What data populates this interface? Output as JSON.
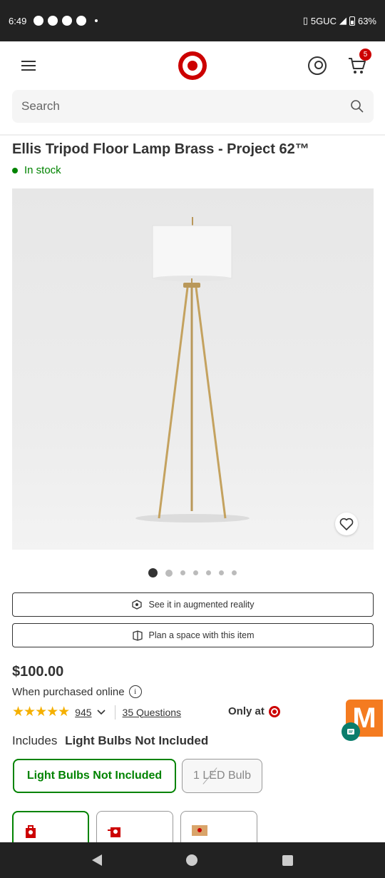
{
  "status_bar": {
    "time": "6:49",
    "network": "5GUC",
    "battery": "63%"
  },
  "header": {
    "cart_count": "5"
  },
  "search": {
    "placeholder": "Search"
  },
  "product": {
    "title": "Ellis Tripod Floor Lamp Brass - Project 62™",
    "stock": "In stock",
    "price": "$100.00",
    "price_note": "When purchased online",
    "rating_stars": "★★★★★",
    "rating_value": 4.6,
    "review_count": "945",
    "questions": "35 Questions",
    "exclusive": "Only at",
    "image_count": 7,
    "active_image": 1
  },
  "actions": {
    "ar": "See it in augmented reality",
    "plan": "Plan a space with this item"
  },
  "variant": {
    "label": "Includes",
    "selected": "Light Bulbs Not Included",
    "options": [
      "Light Bulbs Not Included",
      "1 LED Bulb"
    ]
  },
  "widget": {
    "letter": "M"
  },
  "colors": {
    "brand_red": "#cc0000",
    "stock_green": "#008300",
    "widget_orange": "#f47b20"
  }
}
